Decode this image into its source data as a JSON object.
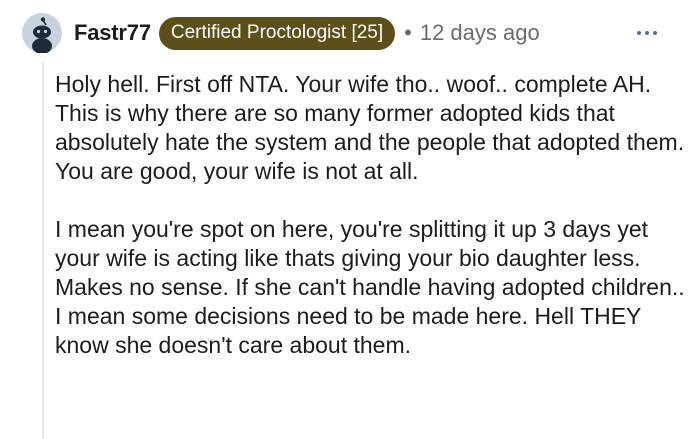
{
  "comment": {
    "author": "Fastr77",
    "flair": "Certified Proctologist [25]",
    "separator": "•",
    "timestamp": "12 days ago",
    "paragraphs": [
      "Holy hell. First off NTA. Your wife tho.. woof.. complete AH. This is why there are so many former adopted kids that absolutely hate the system and the people that adopted them. You are good, your wife is not at all.",
      "I mean you're spot on here, you're splitting it up 3 days yet your wife is acting like thats giving your bio daughter less. Makes no sense. If she can't handle having adopted children.. I mean some decisions need to be made here. Hell THEY know she doesn't care about them."
    ]
  },
  "icons": {
    "avatar": "snoo-avatar-icon",
    "more": "more-options-icon"
  },
  "colors": {
    "flair_bg": "#5c4f1a",
    "flair_text": "#ffffff",
    "avatar_bg": "#c9d3e0",
    "meta_text": "#6b6b6b",
    "more_dots": "#5b6f8a"
  }
}
